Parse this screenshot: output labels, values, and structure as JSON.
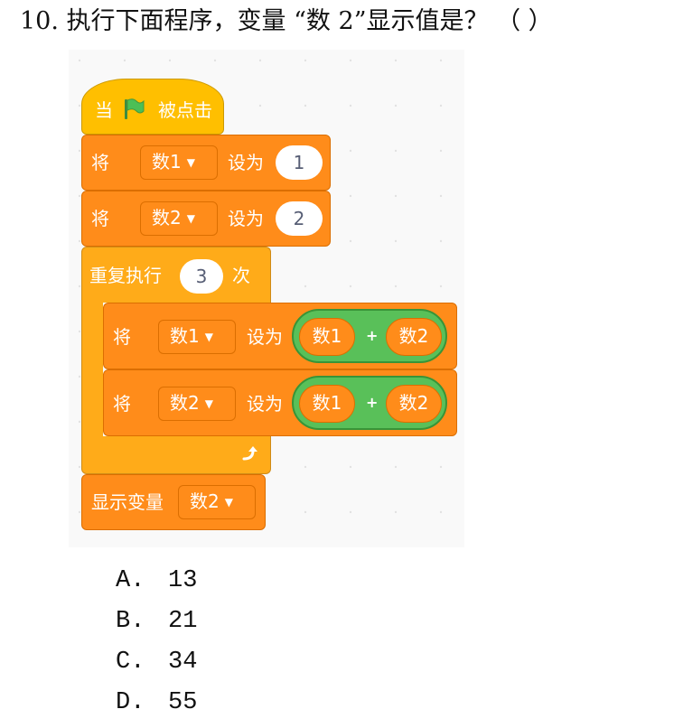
{
  "question": {
    "number": "10.",
    "text": "执行下面程序，变量 “数 2”显示值是？ （ ）"
  },
  "program": {
    "hat": {
      "label_when": "当",
      "flag_icon": "green-flag-icon",
      "label_clicked": "被点击"
    },
    "set_num1": {
      "label": "将",
      "variable": "数1",
      "label_to": "设为",
      "value": "1"
    },
    "set_num2": {
      "label": "将",
      "variable": "数2",
      "label_to": "设为",
      "value": "2"
    },
    "repeat": {
      "label": "重复执行",
      "times": "3",
      "label_times": "次",
      "loop_arrow_icon": "loop-arrow-icon"
    },
    "inner_set_num1": {
      "label": "将",
      "variable": "数1",
      "label_to": "设为",
      "left": "数1",
      "operator": "+",
      "right": "数2"
    },
    "inner_set_num2": {
      "label": "将",
      "variable": "数2",
      "label_to": "设为",
      "left": "数1",
      "operator": "+",
      "right": "数2"
    },
    "show_variable": {
      "label": "显示变量",
      "variable": "数2"
    }
  },
  "options": [
    {
      "letter": "A.",
      "value": "13"
    },
    {
      "letter": "B.",
      "value": "21"
    },
    {
      "letter": "C.",
      "value": "34"
    },
    {
      "letter": "D.",
      "value": "55"
    }
  ],
  "colors": {
    "event": "#ffbf00",
    "variables": "#ff8c1a",
    "control": "#ffab19",
    "operators": "#59c059",
    "background": "#f9f9f9"
  }
}
